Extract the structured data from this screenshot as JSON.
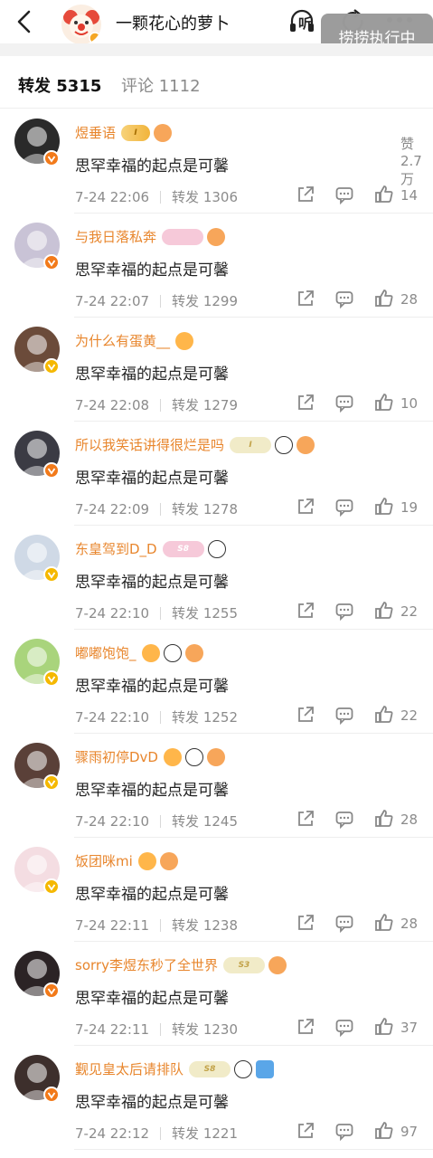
{
  "header": {
    "title": "一颗花心的萝卜",
    "listen_label": "听",
    "overlay_chip": "捞捞执行中"
  },
  "tabs": {
    "reposts": "转发 5315",
    "comments": "评论 1112",
    "likes": "赞 2.7万"
  },
  "reposts": [
    {
      "name": "煜垂语",
      "badges": [
        "gold",
        "fish"
      ],
      "gold_text": "I",
      "content": "思罕幸福的起点是可馨",
      "time": "7-24 22:06",
      "repost_label": "转发 1306",
      "likes": "14",
      "avatar_color": "#2a2a2a",
      "v": "orange"
    },
    {
      "name": "与我日落私奔",
      "badges": [
        "pink",
        "fish"
      ],
      "gold_text": "",
      "content": "思罕幸福的起点是可馨",
      "time": "7-24 22:07",
      "repost_label": "转发 1299",
      "likes": "28",
      "avatar_color": "#c9c3d6",
      "v": "orange"
    },
    {
      "name": "为什么有蛋黄__",
      "badges": [
        "crown"
      ],
      "gold_text": "",
      "content": "思罕幸福的起点是可馨",
      "time": "7-24 22:08",
      "repost_label": "转发 1279",
      "likes": "10",
      "avatar_color": "#6b4b3a",
      "v": "yellow"
    },
    {
      "name": "所以我笑话讲得很烂是吗",
      "badges": [
        "cream",
        "panda",
        "fish"
      ],
      "gold_text": "I",
      "content": "思罕幸福的起点是可馨",
      "time": "7-24 22:09",
      "repost_label": "转发 1278",
      "likes": "19",
      "avatar_color": "#3b3b44",
      "v": "orange"
    },
    {
      "name": "东皇驾到D_D",
      "badges": [
        "pink",
        "panda"
      ],
      "gold_text": "S8",
      "content": "思罕幸福的起点是可馨",
      "time": "7-24 22:10",
      "repost_label": "转发 1255",
      "likes": "22",
      "avatar_color": "#cfd9e6",
      "v": "yellow"
    },
    {
      "name": "嘟嘟饱饱_",
      "badges": [
        "crown",
        "panda",
        "fish"
      ],
      "gold_text": "",
      "content": "思罕幸福的起点是可馨",
      "time": "7-24 22:10",
      "repost_label": "转发 1252",
      "likes": "22",
      "avatar_color": "#a9d47c",
      "v": "yellow"
    },
    {
      "name": "骤雨初停DvD",
      "badges": [
        "crown",
        "panda",
        "fish"
      ],
      "gold_text": "",
      "content": "思罕幸福的起点是可馨",
      "time": "7-24 22:10",
      "repost_label": "转发 1245",
      "likes": "28",
      "avatar_color": "#5a4038",
      "v": "yellow"
    },
    {
      "name": "饭团咪mi",
      "badges": [
        "crown",
        "fish"
      ],
      "gold_text": "",
      "content": "思罕幸福的起点是可馨",
      "time": "7-24 22:11",
      "repost_label": "转发 1238",
      "likes": "28",
      "avatar_color": "#f4dde2",
      "v": "yellow"
    },
    {
      "name": "sorry李煜东秒了全世界",
      "badges": [
        "cream",
        "fish"
      ],
      "gold_text": "S3",
      "content": "思罕幸福的起点是可馨",
      "time": "7-24 22:11",
      "repost_label": "转发 1230",
      "likes": "37",
      "avatar_color": "#2b2325",
      "v": "orange"
    },
    {
      "name": "觐见皇太后请排队",
      "badges": [
        "cream",
        "panda",
        "wave"
      ],
      "gold_text": "S8",
      "content": "思罕幸福的起点是可馨",
      "time": "7-24 22:12",
      "repost_label": "转发 1221",
      "likes": "97",
      "avatar_color": "#3d2f2c",
      "v": "orange"
    }
  ]
}
